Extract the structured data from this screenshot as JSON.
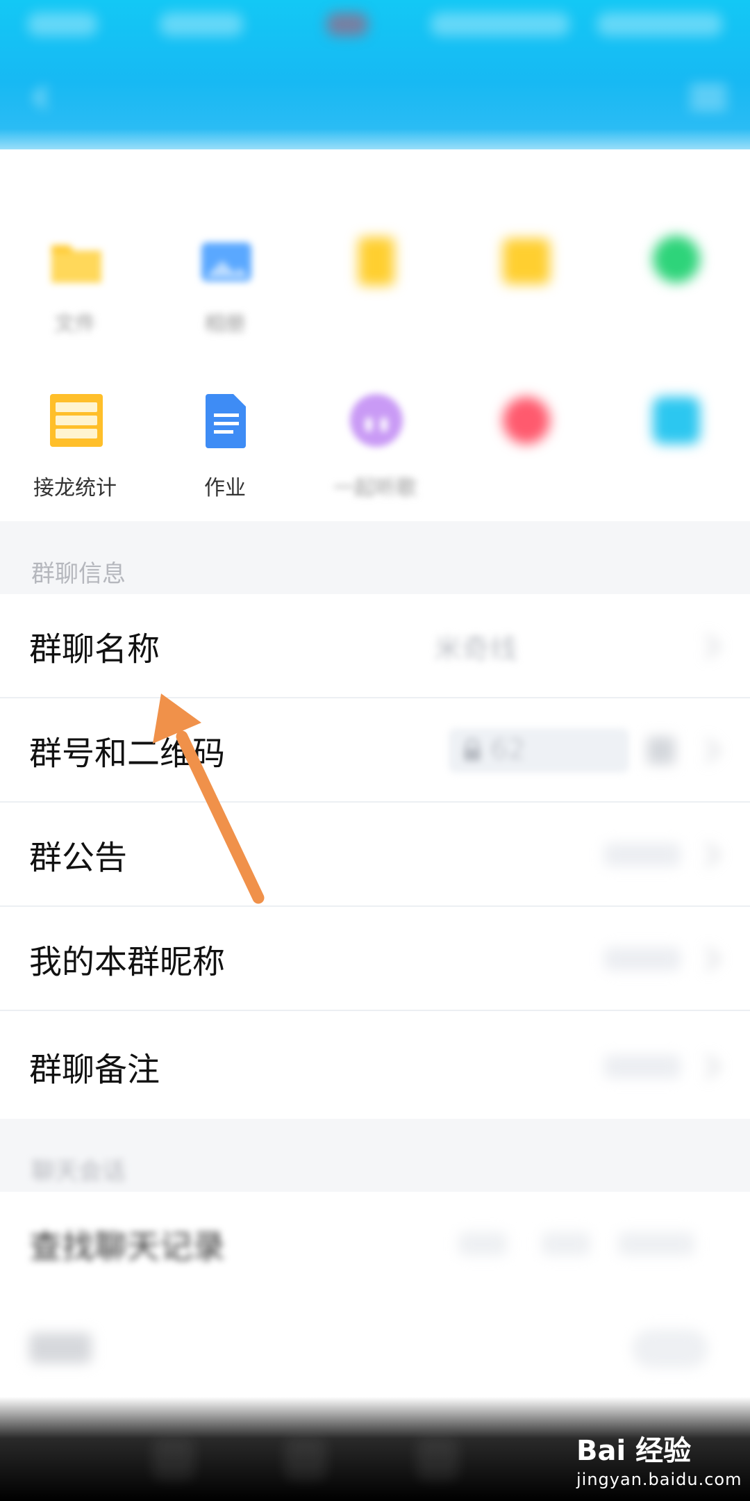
{
  "header": {
    "title": "",
    "bg_color": "#17b9f3"
  },
  "apps": {
    "title": "",
    "items": [
      {
        "label": "文件",
        "icon": "folder-icon",
        "color": "#ffc92e"
      },
      {
        "label": "相册",
        "icon": "photo-album-icon",
        "color": "#5aa8ff"
      },
      {
        "label": "",
        "icon": "document-icon",
        "color": "#ffcf30"
      },
      {
        "label": "",
        "icon": "calendar-icon",
        "color": "#ffcf30"
      },
      {
        "label": "",
        "icon": "green-app-icon",
        "color": "#2ed47a"
      },
      {
        "label": "接龙统计",
        "icon": "list-icon",
        "color": "#ffbf2a"
      },
      {
        "label": "作业",
        "icon": "homework-icon",
        "color": "#3e8cf5"
      },
      {
        "label": "一起听歌",
        "icon": "headphones-icon",
        "color": "#b06cf0"
      },
      {
        "label": "",
        "icon": "red-app-icon",
        "color": "#ff5a6e"
      },
      {
        "label": "",
        "icon": "cyan-app-icon",
        "color": "#2cc7f0"
      }
    ]
  },
  "group_info": {
    "section_title": "群聊信息",
    "rows": [
      {
        "label": "群聊名称",
        "value": "米奇线"
      },
      {
        "label": "群号和二维码",
        "value": "62"
      },
      {
        "label": "群公告",
        "value": ""
      },
      {
        "label": "我的本群昵称",
        "value": ""
      },
      {
        "label": "群聊备注",
        "value": ""
      }
    ]
  },
  "chat_session": {
    "section_title": "聊天会话",
    "rows": [
      {
        "label": "查找聊天记录"
      },
      {
        "label": ""
      }
    ]
  },
  "watermark": {
    "brand": "Bai 经验",
    "domain": "jingyan.baidu.com"
  },
  "colors": {
    "annotation_arrow": "#f0914a",
    "section_bg": "#f5f6f8"
  }
}
